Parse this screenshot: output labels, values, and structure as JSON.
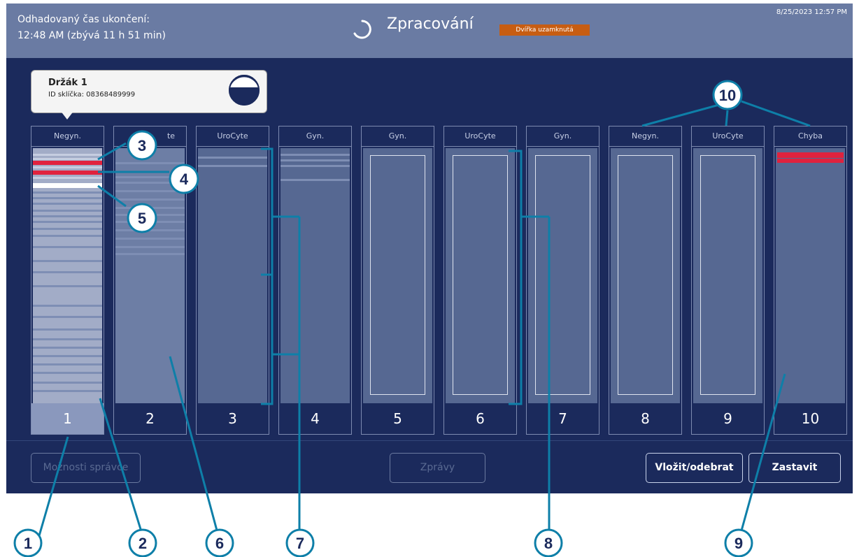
{
  "header": {
    "eta_line1": "Odhadovaný čas ukončení:",
    "eta_line2": "12:48 AM (zbývá 11 h 51 min)",
    "title": "Zpracování",
    "lock_badge": "Dvířka uzamknutá",
    "datetime": "8/25/2023 12:57 PM"
  },
  "tooltip": {
    "holder": "Držák 1",
    "slide_id": "ID sklíčka: 08368489999"
  },
  "slots": [
    {
      "label": "Negyn.",
      "number": "1"
    },
    {
      "label": "",
      "label_suffix": "te",
      "number": "2"
    },
    {
      "label": "UroCyte",
      "number": "3"
    },
    {
      "label": "Gyn.",
      "number": "4"
    },
    {
      "label": "Gyn.",
      "number": "5"
    },
    {
      "label": "UroCyte",
      "number": "6"
    },
    {
      "label": "Gyn.",
      "number": "7"
    },
    {
      "label": "Negyn.",
      "number": "8"
    },
    {
      "label": "UroCyte",
      "number": "9"
    },
    {
      "label": "Chyba",
      "number": "10"
    }
  ],
  "buttons": {
    "admin_options": "Možnosti správce",
    "messages": "Zprávy",
    "load_unload": "Vložit/odebrat",
    "stop": "Zastavit"
  },
  "callouts": [
    "1",
    "2",
    "3",
    "4",
    "5",
    "6",
    "7",
    "8",
    "9",
    "10"
  ],
  "colors": {
    "background": "#1b2a5c",
    "topbar": "#6a7ba3",
    "callout": "#0e7fa8",
    "error_row": "#e0223e",
    "lock_badge": "#c75d12"
  }
}
